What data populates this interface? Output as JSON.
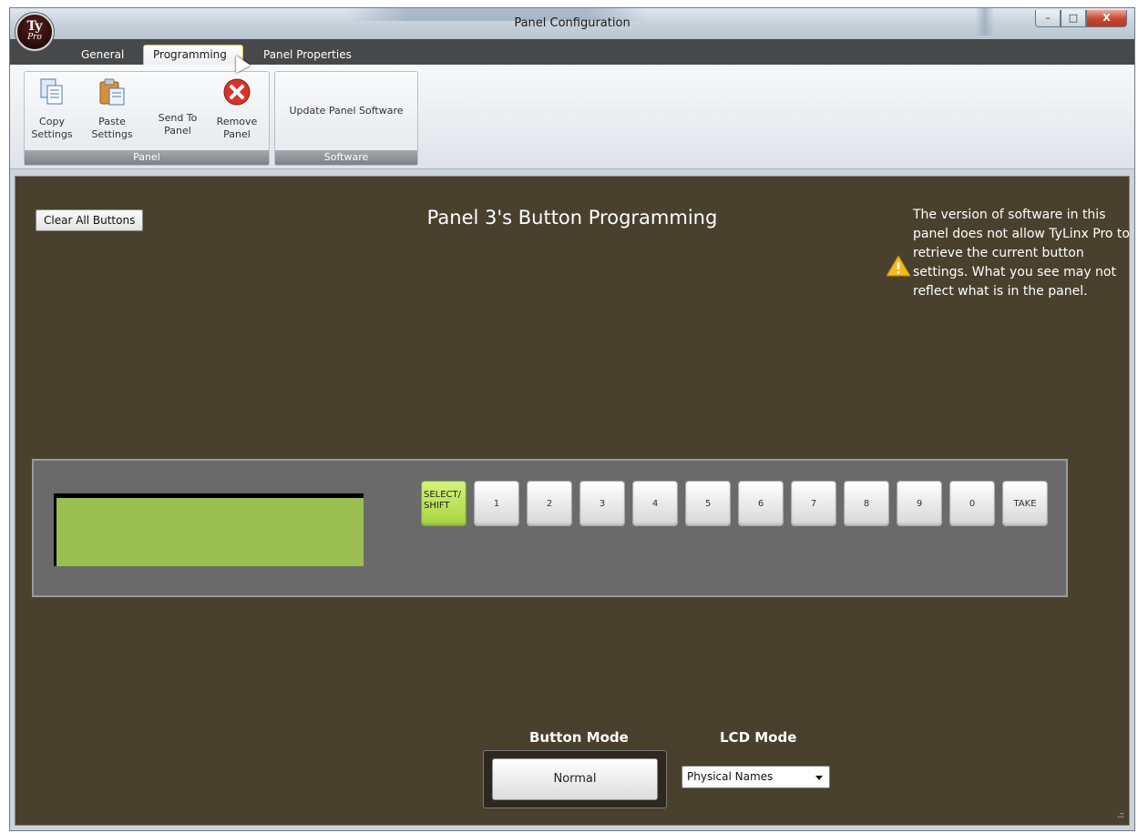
{
  "window": {
    "title": "Panel Configuration",
    "logo_top": "Ty",
    "logo_bottom": "Pro",
    "controls": {
      "minimize": "–",
      "maximize": "□",
      "close": "X"
    }
  },
  "tabs": [
    {
      "label": "General"
    },
    {
      "label": "Programming",
      "active": true
    },
    {
      "label": "Panel Properties"
    }
  ],
  "ribbon": {
    "panel_group": {
      "label": "Panel",
      "buttons": [
        {
          "label": "Copy Settings",
          "icon": "copy-icon"
        },
        {
          "label": "Paste Settings",
          "icon": "paste-icon"
        },
        {
          "label": "Send To Panel",
          "icon": ""
        },
        {
          "label": "Remove Panel",
          "icon": "remove-icon"
        }
      ]
    },
    "software_group": {
      "label": "Software",
      "buttons": [
        {
          "label": "Update Panel Software"
        }
      ]
    }
  },
  "content": {
    "clear_button": "Clear All Buttons",
    "heading": "Panel 3's Button Programming",
    "warning": "The version of software in this panel does not allow TyLinx Pro to retrieve the current button settings. What you see may not reflect what is in the panel.",
    "panel_buttons": [
      "SELECT/ SHIFT",
      "1",
      "2",
      "3",
      "4",
      "5",
      "6",
      "7",
      "8",
      "9",
      "0",
      "TAKE"
    ],
    "button_mode_label": "Button Mode",
    "button_mode_value": "Normal",
    "lcd_mode_label": "LCD Mode",
    "lcd_mode_value": "Physical Names"
  },
  "colors": {
    "content_bg": "#49412e",
    "lcd_green": "#9abf50",
    "select_shift_green": "#b7e05a",
    "tab_bar": "#46484a"
  }
}
